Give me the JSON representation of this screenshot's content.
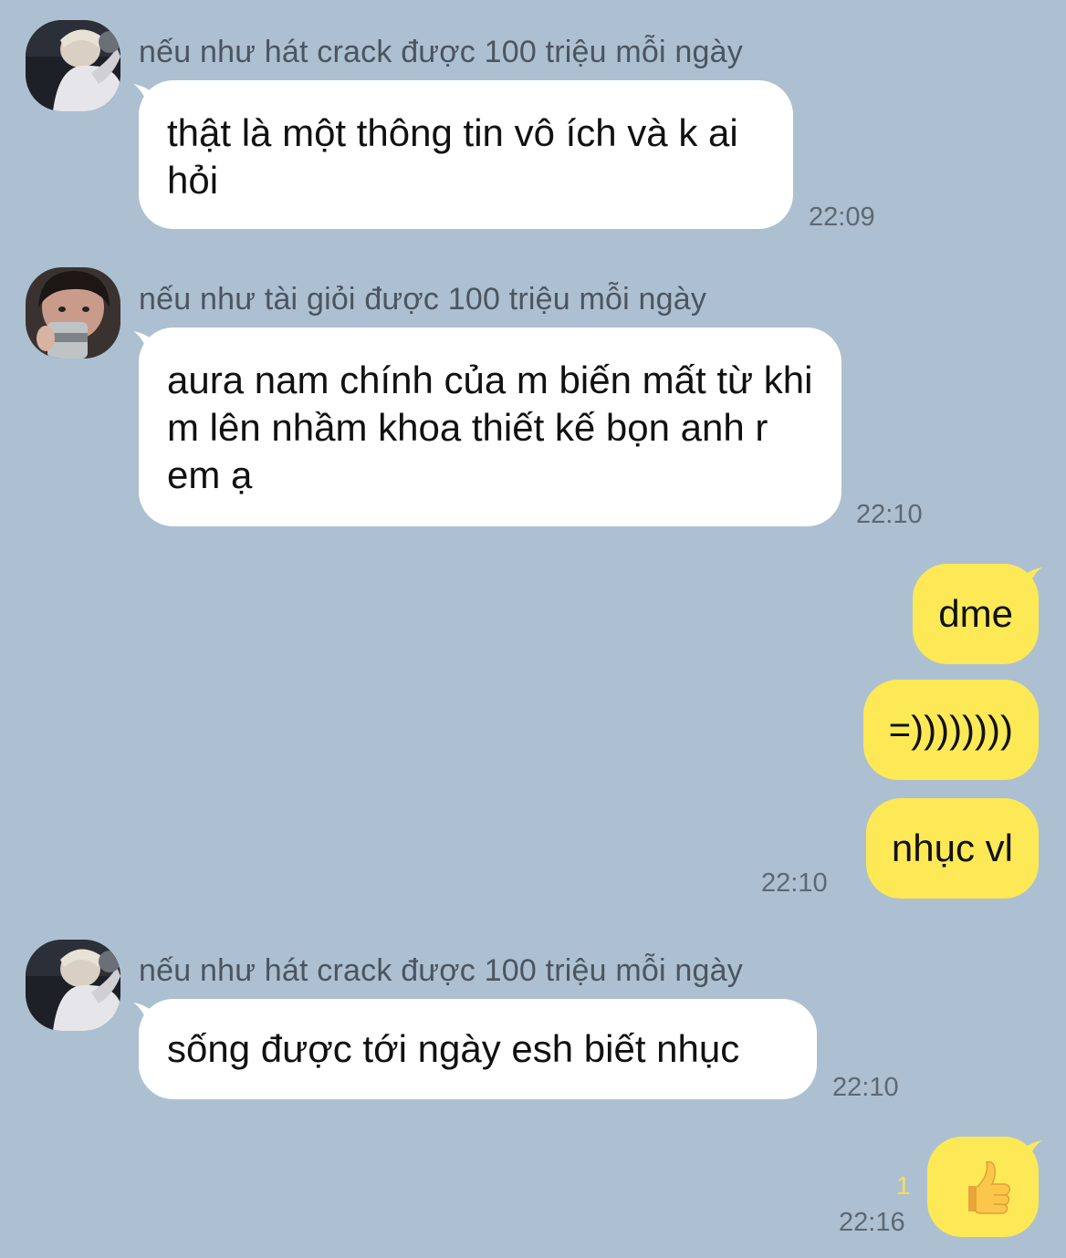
{
  "messages": [
    {
      "sender": "nếu như hát crack được 100 triệu mỗi ngày",
      "text": "thật là một thông tin vô ích và k ai hỏi",
      "time": "22:09"
    },
    {
      "sender": "nếu như tài giỏi được 100 triệu mỗi ngày",
      "text": "aura nam chính của m biến mất từ khi m lên nhầm khoa thiết kế bọn anh r em ạ",
      "time": "22:10"
    },
    {
      "outgoing": [
        "dme",
        "=))))))))",
        "nhục vl"
      ],
      "time": "22:10"
    },
    {
      "sender": "nếu như hát crack được 100 triệu mỗi ngày",
      "text": "sống được tới ngày esh biết nhục",
      "time": "22:10"
    },
    {
      "outgoing": [
        "👍"
      ],
      "read_count": "1",
      "time": "22:16"
    }
  ],
  "colors": {
    "background": "#adc0d1",
    "incoming_bubble": "#ffffff",
    "outgoing_bubble": "#fde956",
    "read_indicator": "#f3e24a"
  },
  "icons": {
    "avatar_1": "profile-photo-avatar",
    "avatar_2": "profile-photo-avatar",
    "reaction": "thumbs-up-emoji"
  }
}
